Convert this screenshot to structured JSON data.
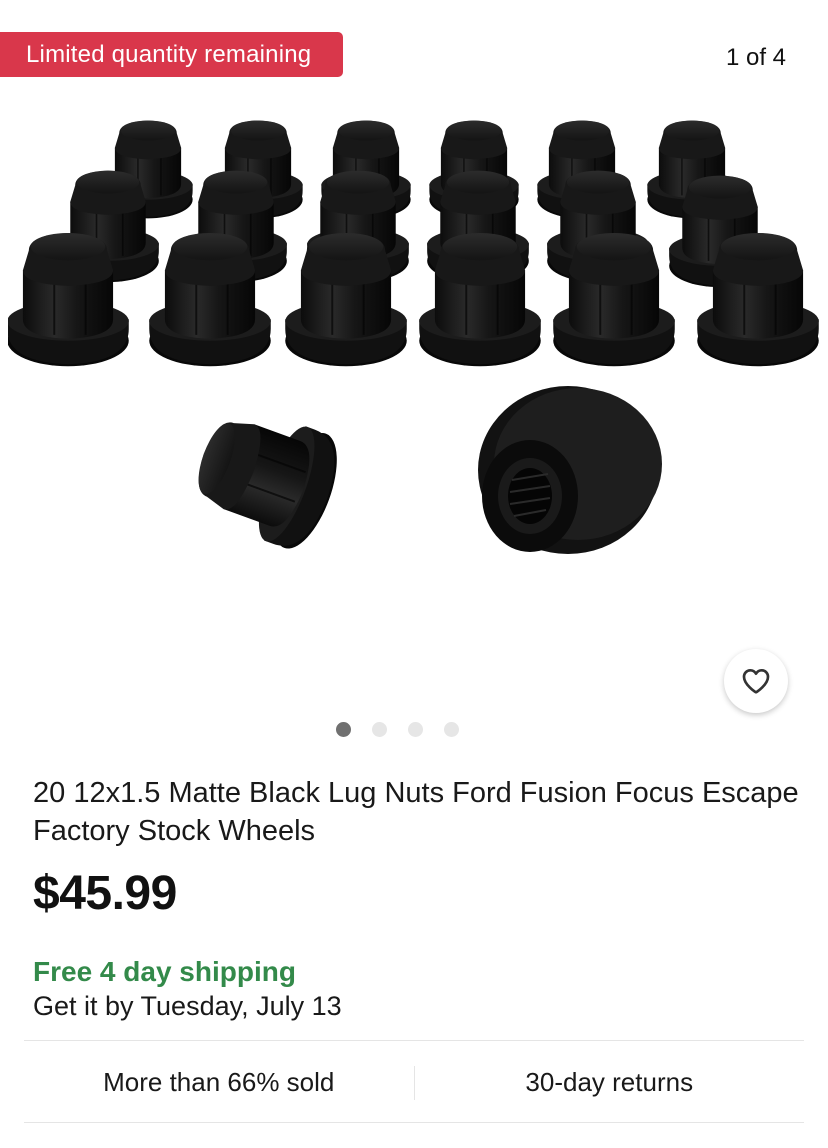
{
  "gallery": {
    "badge": "Limited quantity remaining",
    "counter": "1 of 4",
    "image_alt": "20 matte black lug nuts",
    "dots_count": 4,
    "active_dot": 1,
    "favorite_icon": "heart-outline-icon"
  },
  "listing": {
    "title": "20 12x1.5 Matte Black Lug Nuts Ford Fusion Focus Escape Factory Stock Wheels",
    "price": "$45.99",
    "shipping": "Free 4 day shipping",
    "delivery": "Get it by Tuesday, July 13"
  },
  "stats": {
    "sold": "More than 66% sold",
    "returns": "30-day returns"
  },
  "colors": {
    "badge_bg": "#d9374b",
    "shipping_green": "#338a4a",
    "active_dot": "#707070"
  }
}
